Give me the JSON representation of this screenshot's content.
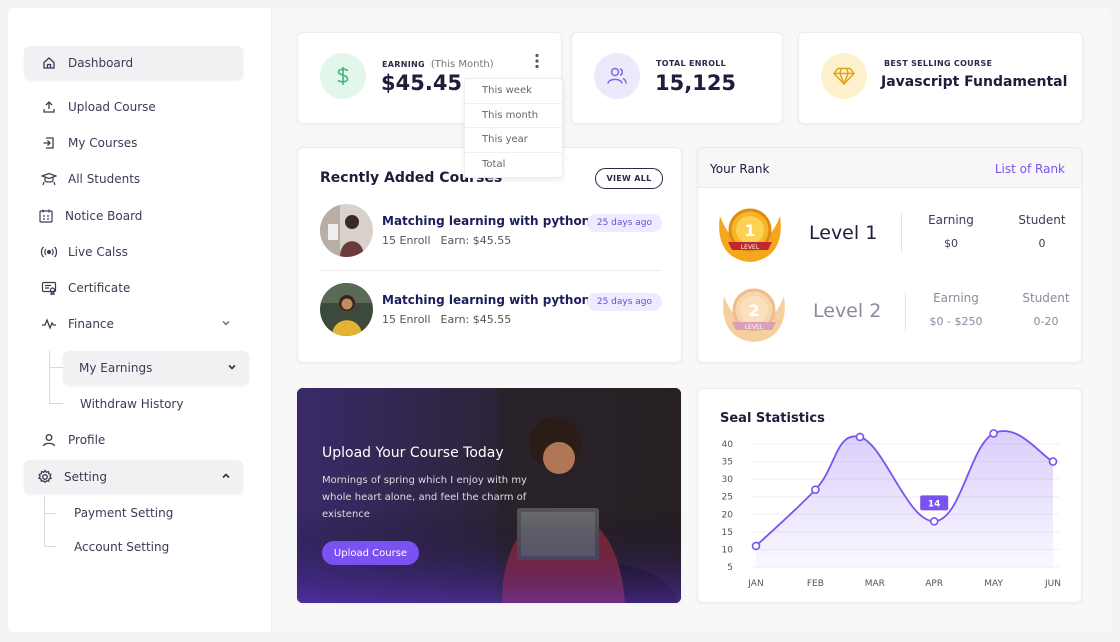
{
  "sidebar": {
    "items": [
      {
        "label": "Dashboard",
        "icon": "home-icon"
      },
      {
        "label": "Upload Course",
        "icon": "upload-icon"
      },
      {
        "label": "My Courses",
        "icon": "enter-icon"
      },
      {
        "label": "All Students",
        "icon": "students-icon"
      },
      {
        "label": "Notice Board",
        "icon": "notice-icon"
      },
      {
        "label": "Live Calss",
        "icon": "broadcast-icon"
      },
      {
        "label": "Certificate",
        "icon": "certificate-icon"
      },
      {
        "label": "Finance",
        "icon": "pulse-icon"
      },
      {
        "label": "Profile",
        "icon": "user-icon"
      },
      {
        "label": "Setting",
        "icon": "gear-icon"
      }
    ],
    "finance_sub": [
      "My Earnings",
      "Withdraw History"
    ],
    "setting_sub": [
      "Payment Setting",
      "Account Setting"
    ]
  },
  "stats": {
    "earning": {
      "label": "EARNING",
      "period": "(This Month)",
      "value": "$45.45"
    },
    "enroll": {
      "label": "TOTAL ENROLL",
      "value": "15,125"
    },
    "best": {
      "label": "BEST SELLING COURSE",
      "value": "Javascript Fundamental"
    }
  },
  "dropdown": [
    "This week",
    "This month",
    "This year",
    "Total"
  ],
  "recent": {
    "title": "Recntly Added Courses",
    "view_all": "VIEW ALL",
    "courses": [
      {
        "title": "Matching learning with python",
        "enroll": "15 Enroll",
        "earn": "Earn: $45.55",
        "ago": "25 days ago"
      },
      {
        "title": "Matching learning with python",
        "enroll": "15 Enroll",
        "earn": "Earn: $45.55",
        "ago": "25 days ago"
      }
    ]
  },
  "rank": {
    "title": "Your Rank",
    "link": "List of Rank",
    "earning_label": "Earning",
    "student_label": "Student",
    "medal_text": "LEVEL",
    "levels": [
      {
        "num": "1",
        "name": "Level 1",
        "earning": "$0",
        "student": "0"
      },
      {
        "num": "2",
        "name": "Level 2",
        "earning": "$0 - $250",
        "student": "0-20"
      }
    ]
  },
  "promo": {
    "title": "Upload Your Course Today",
    "text": "Mornings of spring which I enjoy with my whole heart alone, and feel the charm of existence",
    "button": "Upload Course"
  },
  "colors": {
    "accent": "#7b52f2",
    "earning": "#3fb67a",
    "enroll": "#7b6ae6",
    "best": "#e4a51e"
  },
  "chart_data": {
    "type": "area",
    "title": "Seal Statistics",
    "categories": [
      "JAN",
      "FEB",
      "MAR",
      "APR",
      "MAY",
      "JUN"
    ],
    "x": [
      0,
      1,
      1.75,
      3,
      4,
      5
    ],
    "values": [
      11,
      27,
      42,
      18,
      43,
      35
    ],
    "highlight": {
      "category": "APR",
      "label": "14"
    },
    "yticks": [
      "40",
      "35",
      "30",
      "25",
      "20",
      "15",
      "10",
      "5"
    ],
    "ylim": [
      5,
      40
    ],
    "grid": true,
    "color": "#7b52f2"
  }
}
